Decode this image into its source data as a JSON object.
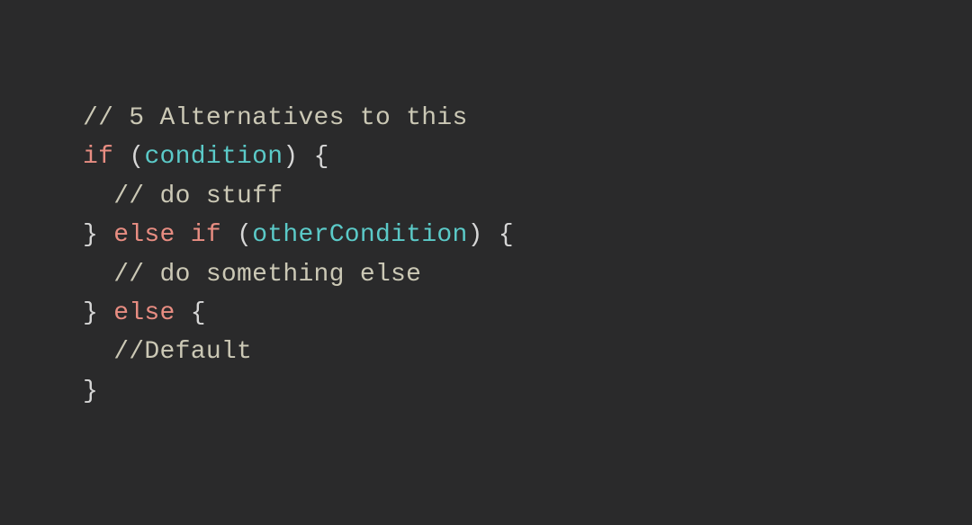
{
  "code": {
    "comment1": "// 5 Alternatives to this",
    "kw_if": "if",
    "paren_open": " (",
    "cond1": "condition",
    "paren_close_brace": ") {",
    "comment2": "  // do stuff",
    "close_else_if": "} ",
    "kw_else": "else",
    "space": " ",
    "kw_if2": "if",
    "paren_open2": " (",
    "cond2": "otherCondition",
    "paren_close_brace2": ") {",
    "comment3": "  // do something else",
    "close_else": "} ",
    "kw_else2": "else",
    "brace_open": " {",
    "comment4": "  //Default",
    "close_brace": "}"
  }
}
